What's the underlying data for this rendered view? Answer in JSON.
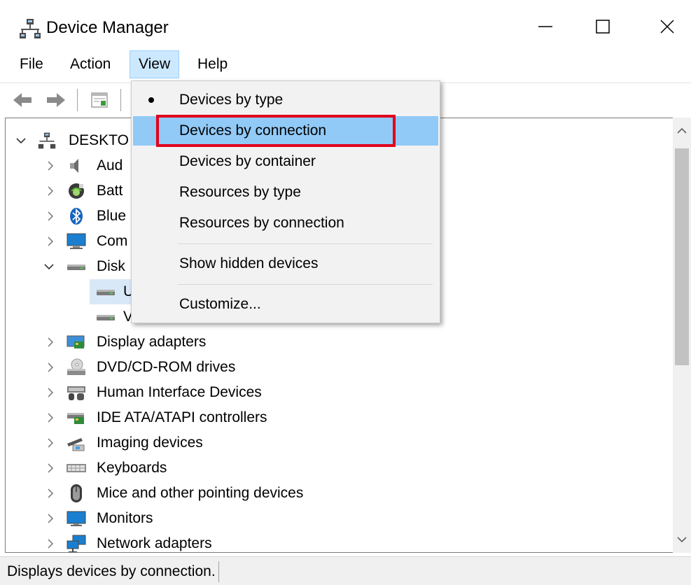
{
  "window": {
    "title": "Device Manager",
    "controls": [
      "minimize",
      "maximize",
      "close"
    ]
  },
  "menubar": {
    "items": [
      "File",
      "Action",
      "View",
      "Help"
    ],
    "active": "View"
  },
  "toolbar": {
    "icons": [
      "back-arrow-icon",
      "forward-arrow-icon",
      "properties-icon"
    ]
  },
  "view_menu": {
    "items": [
      {
        "label": "Devices by type",
        "checked": true
      },
      {
        "label": "Devices by connection",
        "checked": false,
        "hovered": true
      },
      {
        "label": "Devices by container",
        "checked": false
      },
      {
        "label": "Resources by type",
        "checked": false
      },
      {
        "label": "Resources by connection",
        "checked": false
      },
      {
        "label": "Show hidden devices",
        "checked": false
      },
      {
        "label": "Customize...",
        "checked": false
      }
    ]
  },
  "tree": {
    "root": "DESKTO",
    "rows": [
      {
        "label": "Aud",
        "icon": "audio-icon",
        "expanded": false
      },
      {
        "label": "Batt",
        "icon": "battery-icon",
        "expanded": false
      },
      {
        "label": "Blue",
        "icon": "bluetooth-icon",
        "expanded": false
      },
      {
        "label": "Com",
        "icon": "computer-icon",
        "expanded": false
      },
      {
        "label": "Disk",
        "icon": "disk-drive-icon",
        "expanded": true
      },
      {
        "label": "U",
        "icon": "disk-drive-icon",
        "child": true
      },
      {
        "label": "V",
        "icon": "disk-drive-icon",
        "child": true
      },
      {
        "label": "Display adapters",
        "icon": "display-adapter-icon",
        "expanded": false
      },
      {
        "label": "DVD/CD-ROM drives",
        "icon": "dvd-drive-icon",
        "expanded": false
      },
      {
        "label": "Human Interface Devices",
        "icon": "hid-icon",
        "expanded": false
      },
      {
        "label": "IDE ATA/ATAPI controllers",
        "icon": "ide-controller-icon",
        "expanded": false
      },
      {
        "label": "Imaging devices",
        "icon": "imaging-icon",
        "expanded": false
      },
      {
        "label": "Keyboards",
        "icon": "keyboard-icon",
        "expanded": false
      },
      {
        "label": "Mice and other pointing devices",
        "icon": "mouse-icon",
        "expanded": false
      },
      {
        "label": "Monitors",
        "icon": "monitor-icon",
        "expanded": false
      },
      {
        "label": "Network adapters",
        "icon": "network-adapter-icon",
        "expanded": false
      }
    ]
  },
  "status": {
    "text": "Displays devices by connection."
  },
  "colors": {
    "menu_active_bg": "#cce8ff",
    "dropdown_hover_bg": "#91c9f7",
    "highlight_border": "#e0001b",
    "selected_row_bg": "#d9e8f7"
  }
}
